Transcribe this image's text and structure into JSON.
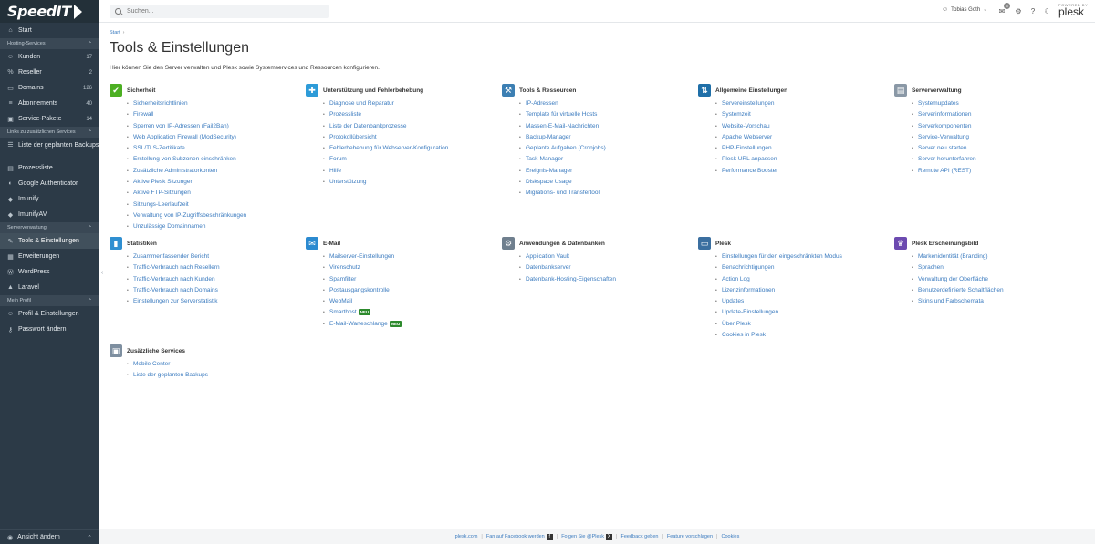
{
  "app": {
    "logo": "SpeedIT"
  },
  "sidebar": {
    "top": [
      {
        "label": "Start",
        "icon": "home-icon"
      }
    ],
    "sections": [
      {
        "title": "Hosting-Services",
        "items": [
          {
            "label": "Kunden",
            "count": "17",
            "icon": "user-icon"
          },
          {
            "label": "Reseller",
            "count": "2",
            "icon": "percent-icon"
          },
          {
            "label": "Domains",
            "count": "126",
            "icon": "monitor-icon"
          },
          {
            "label": "Abonnements",
            "count": "40",
            "icon": "layers-icon"
          },
          {
            "label": "Service-Pakete",
            "count": "14",
            "icon": "package-icon"
          }
        ]
      },
      {
        "title": "Links zu zusätzlichen Services",
        "items": [
          {
            "label": "Liste der geplanten Backups",
            "icon": "list-icon"
          },
          {
            "label": "Prozessliste",
            "icon": "process-icon"
          },
          {
            "label": "Google Authenticator",
            "icon": "google-icon"
          },
          {
            "label": "Imunify",
            "icon": "shield-icon"
          },
          {
            "label": "ImunifyAV",
            "icon": "shield-icon"
          }
        ]
      },
      {
        "title": "Serververwaltung",
        "items": [
          {
            "label": "Tools & Einstellungen",
            "icon": "tools-icon",
            "active": true
          },
          {
            "label": "Erweiterungen",
            "icon": "grid-icon"
          },
          {
            "label": "WordPress",
            "icon": "wordpress-icon"
          },
          {
            "label": "Laravel",
            "icon": "laravel-icon"
          }
        ]
      },
      {
        "title": "Mein Profil",
        "items": [
          {
            "label": "Profil & Einstellungen",
            "icon": "profile-icon"
          },
          {
            "label": "Passwort ändern",
            "icon": "key-icon"
          }
        ]
      }
    ],
    "bottom": {
      "label": "Ansicht ändern",
      "icon": "view-icon"
    }
  },
  "header": {
    "search_placeholder": "Suchen...",
    "user": "Tobias Goth",
    "notifications": "3",
    "powered_by": "POWERED BY",
    "brand": "plesk"
  },
  "main": {
    "breadcrumb": "Start",
    "title": "Tools & Einstellungen",
    "description": "Hier können Sie den Server verwalten und Plesk sowie Systemservices und Ressourcen konfigurieren.",
    "groups": [
      {
        "title": "Sicherheit",
        "icon": "security-icon",
        "color": "#4caf22",
        "links": [
          "Sicherheitsrichtlinien",
          "Firewall",
          "Sperren von IP-Adressen (Fail2Ban)",
          "Web Application Firewall (ModSecurity)",
          "SSL/TLS-Zertifikate",
          "Erstellung von Subzonen einschränken",
          "Zusätzliche Administratorkonten",
          "Aktive Plesk Sitzungen",
          "Aktive FTP-Sitzungen",
          "Sitzungs-Leerlaufzeit",
          "Verwaltung von IP-Zugriffsbeschränkungen",
          "Unzulässige Domainnamen"
        ]
      },
      {
        "title": "Unterstützung und Fehlerbehebung",
        "icon": "support-icon",
        "color": "#2d9bd8",
        "links": [
          "Diagnose und Reparatur",
          "Prozessliste",
          "Liste der Datenbankprozesse",
          "Protokollübersicht",
          "Fehlerbehebung für Webserver-Konfiguration",
          "Forum",
          "Hilfe",
          "Unterstützung"
        ]
      },
      {
        "title": "Tools & Ressourcen",
        "icon": "tools-resources-icon",
        "color": "#3c7fb3",
        "links": [
          "IP-Adressen",
          "Template für virtuelle Hosts",
          "Massen-E-Mail-Nachrichten",
          "Backup-Manager",
          "Geplante Aufgaben (Cronjobs)",
          "Task-Manager",
          "Ereignis-Manager",
          "Diskspace Usage",
          "Migrations- und Transfertool"
        ]
      },
      {
        "title": "Allgemeine Einstellungen",
        "icon": "settings-sliders-icon",
        "color": "#1f6fa8",
        "links": [
          "Servereinstellungen",
          "Systemzeit",
          "Website-Vorschau",
          "Apache Webserver",
          "PHP-Einstellungen",
          "Plesk URL anpassen",
          "Performance Booster"
        ]
      },
      {
        "title": "Serververwaltung",
        "icon": "server-icon",
        "color": "#8a98a6",
        "links": [
          "Systemupdates",
          "Serverinformationen",
          "Serverkomponenten",
          "Service-Verwaltung",
          "Server neu starten",
          "Server herunterfahren",
          "Remote API (REST)"
        ]
      },
      {
        "title": "Statistiken",
        "icon": "statistics-icon",
        "color": "#2f8fd1",
        "links": [
          "Zusammenfassender Bericht",
          "Traffic-Verbrauch nach Resellern",
          "Traffic-Verbrauch nach Kunden",
          "Traffic-Verbrauch nach Domains",
          "Einstellungen zur Serverstatistik"
        ]
      },
      {
        "title": "E-Mail",
        "icon": "mail-icon",
        "color": "#2b8ad0",
        "links": [
          "Mailserver-Einstellungen",
          "Virenschutz",
          "Spamfilter",
          "Postausgangskontrolle",
          "WebMail",
          "Smarthost",
          "E-Mail-Warteschlange"
        ],
        "badges": {
          "5": "NEU",
          "6": "NEU"
        }
      },
      {
        "title": "Anwendungen & Datenbanken",
        "icon": "apps-db-icon",
        "color": "#6f7f8e",
        "links": [
          "Application Vault",
          "Datenbankserver",
          "Datenbank-Hosting-Eigenschaften"
        ]
      },
      {
        "title": "Plesk",
        "icon": "plesk-window-icon",
        "color": "#3b6fa0",
        "links": [
          "Einstellungen für den eingeschränkten Modus",
          "Benachrichtigungen",
          "Action Log",
          "Lizenzinformationen",
          "Updates",
          "Update-Einstellungen",
          "Über Plesk",
          "Cookies in Plesk"
        ]
      },
      {
        "title": "Plesk Erscheinungsbild",
        "icon": "appearance-icon",
        "color": "#6c4ab0",
        "links": [
          "Markenidentität (Branding)",
          "Sprachen",
          "Verwaltung der Oberfläche",
          "Benutzerdefinierte Schaltflächen",
          "Skins und Farbschemata"
        ]
      },
      {
        "title": "Zusätzliche Services",
        "icon": "additional-services-icon",
        "color": "#7e8fa0",
        "links": [
          "Mobile Center",
          "Liste der geplanten Backups"
        ]
      }
    ]
  },
  "footer": {
    "links": [
      "plesk.com",
      "Fan auf Facebook werden",
      "Folgen Sie @Plesk",
      "Feedback geben",
      "Feature vorschlagen",
      "Cookies"
    ]
  }
}
